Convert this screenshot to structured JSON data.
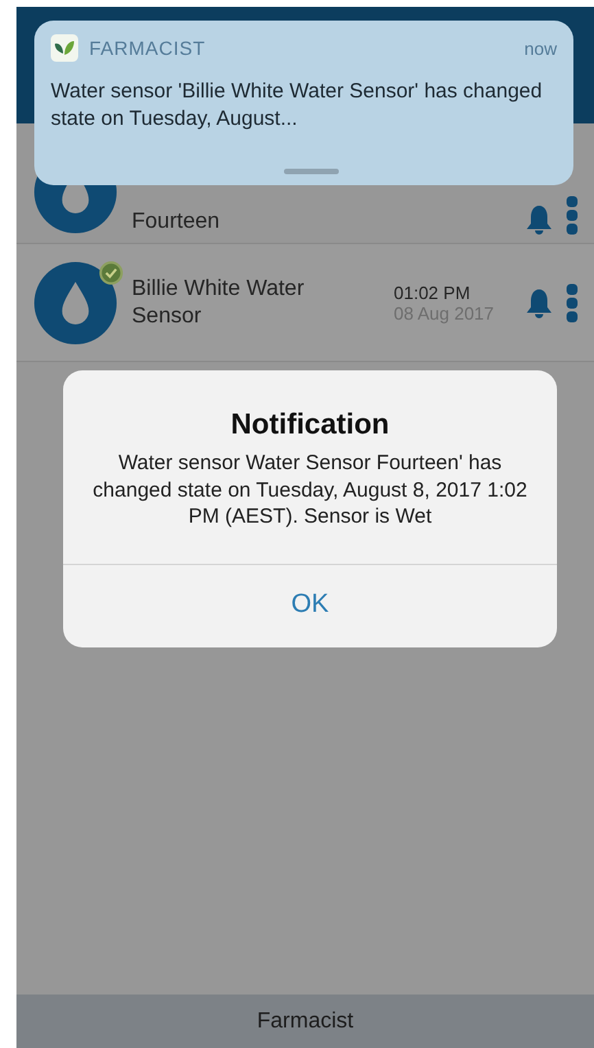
{
  "banner": {
    "app_name": "FARMACIST",
    "time": "now",
    "message": "Water sensor 'Billie White Water Sensor' has changed state on Tuesday, August..."
  },
  "sensors": [
    {
      "name": "Fourteen"
    },
    {
      "name": "Billie White Water Sensor",
      "time": "01:02 PM",
      "date": "08 Aug 2017",
      "checked": true
    }
  ],
  "dialog": {
    "title": "Notification",
    "message": "Water sensor Water Sensor Fourteen' has changed state on Tuesday, August 8, 2017 1:02 PM (AEST). Sensor is Wet",
    "button": "OK"
  },
  "bottom_bar": {
    "title": "Farmacist"
  }
}
